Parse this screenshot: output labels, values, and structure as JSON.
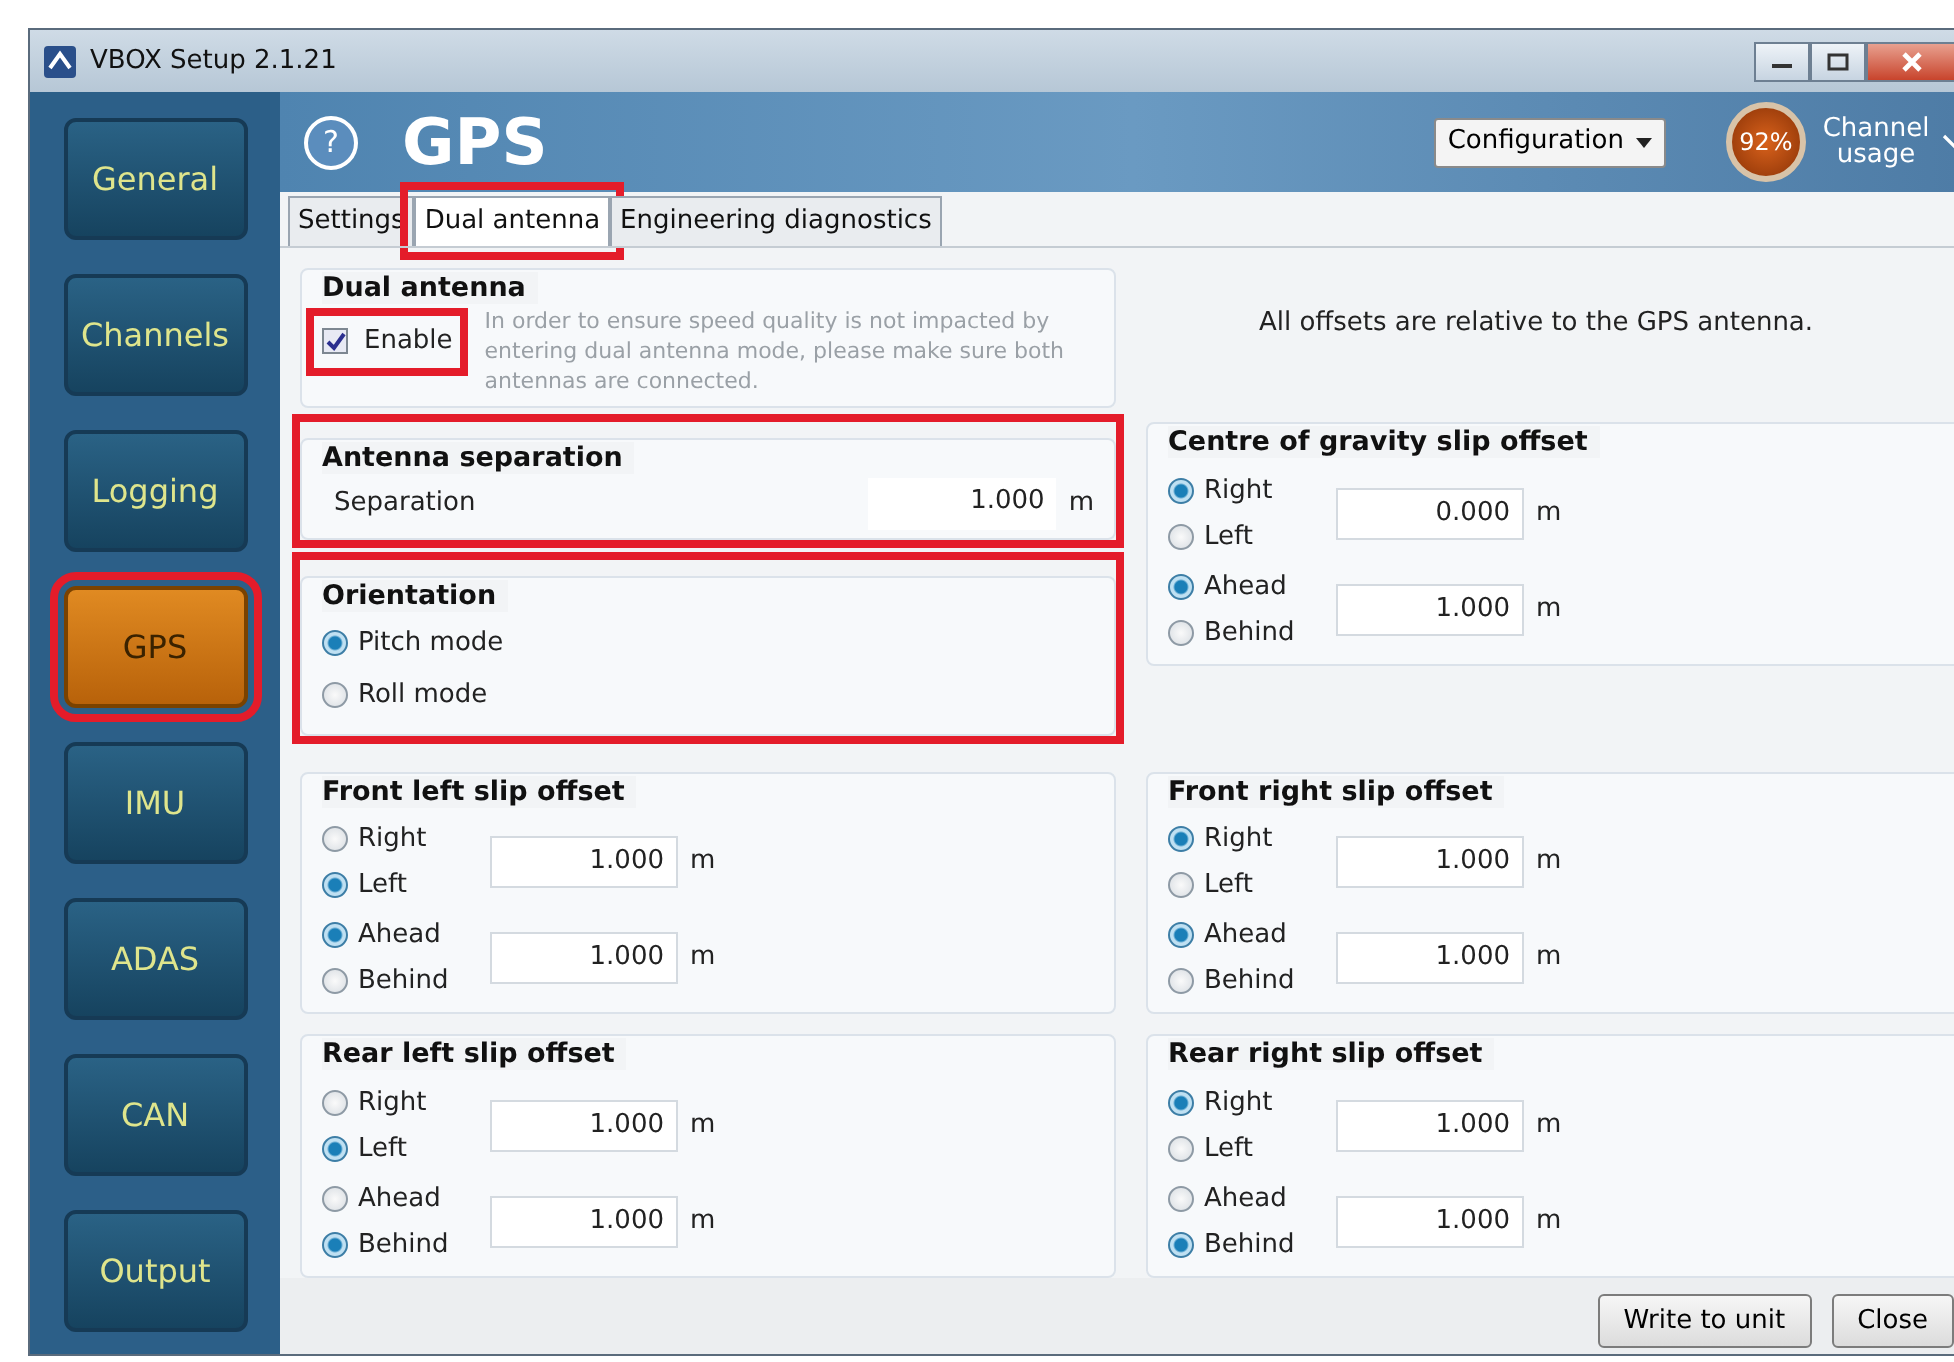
{
  "window": {
    "title": "VBOX Setup 2.1.21"
  },
  "sidebar": {
    "items": [
      {
        "label": "General",
        "selected": false,
        "highlighted": false
      },
      {
        "label": "Channels",
        "selected": false,
        "highlighted": false
      },
      {
        "label": "Logging",
        "selected": false,
        "highlighted": false
      },
      {
        "label": "GPS",
        "selected": true,
        "highlighted": true
      },
      {
        "label": "IMU",
        "selected": false,
        "highlighted": false
      },
      {
        "label": "ADAS",
        "selected": false,
        "highlighted": false
      },
      {
        "label": "CAN",
        "selected": false,
        "highlighted": false
      },
      {
        "label": "Output",
        "selected": false,
        "highlighted": false
      }
    ]
  },
  "header": {
    "help": "?",
    "title": "GPS",
    "configuration": "Configuration",
    "usage_percent": "92%",
    "usage_label": "Channel usage"
  },
  "tabs": [
    {
      "label": "Settings",
      "selected": false,
      "highlighted": false
    },
    {
      "label": "Dual antenna",
      "selected": true,
      "highlighted": true
    },
    {
      "label": "Engineering diagnostics",
      "selected": false,
      "highlighted": false
    }
  ],
  "dual_antenna": {
    "title": "Dual antenna",
    "enable": {
      "label": "Enable",
      "checked": true,
      "highlighted": true
    },
    "note": "In order to ensure speed quality is not impacted by entering dual antenna mode, please make sure both antennas are connected."
  },
  "offsets_note": "All offsets are relative to the GPS antenna.",
  "antenna_separation": {
    "title": "Antenna separation",
    "highlighted": true,
    "label": "Separation",
    "value": "1.000",
    "unit": "m"
  },
  "orientation": {
    "title": "Orientation",
    "highlighted": true,
    "options": [
      {
        "label": "Pitch mode",
        "selected": true
      },
      {
        "label": "Roll mode",
        "selected": false
      }
    ]
  },
  "cog_offset": {
    "title": "Centre of gravity slip offset",
    "rows": [
      {
        "options": [
          {
            "label": "Right",
            "selected": true
          },
          {
            "label": "Left",
            "selected": false
          }
        ],
        "value": "0.000",
        "unit": "m"
      },
      {
        "options": [
          {
            "label": "Ahead",
            "selected": true
          },
          {
            "label": "Behind",
            "selected": false
          }
        ],
        "value": "1.000",
        "unit": "m"
      }
    ]
  },
  "wheel_offsets": [
    {
      "title": "Front left slip offset",
      "rows": [
        {
          "options": [
            {
              "label": "Right",
              "selected": false
            },
            {
              "label": "Left",
              "selected": true
            }
          ],
          "value": "1.000",
          "unit": "m"
        },
        {
          "options": [
            {
              "label": "Ahead",
              "selected": true
            },
            {
              "label": "Behind",
              "selected": false
            }
          ],
          "value": "1.000",
          "unit": "m"
        }
      ]
    },
    {
      "title": "Front right slip offset",
      "rows": [
        {
          "options": [
            {
              "label": "Right",
              "selected": true
            },
            {
              "label": "Left",
              "selected": false
            }
          ],
          "value": "1.000",
          "unit": "m"
        },
        {
          "options": [
            {
              "label": "Ahead",
              "selected": true
            },
            {
              "label": "Behind",
              "selected": false
            }
          ],
          "value": "1.000",
          "unit": "m"
        }
      ]
    },
    {
      "title": "Rear left slip offset",
      "rows": [
        {
          "options": [
            {
              "label": "Right",
              "selected": false
            },
            {
              "label": "Left",
              "selected": true
            }
          ],
          "value": "1.000",
          "unit": "m"
        },
        {
          "options": [
            {
              "label": "Ahead",
              "selected": false
            },
            {
              "label": "Behind",
              "selected": true
            }
          ],
          "value": "1.000",
          "unit": "m"
        }
      ]
    },
    {
      "title": "Rear right slip offset",
      "rows": [
        {
          "options": [
            {
              "label": "Right",
              "selected": true
            },
            {
              "label": "Left",
              "selected": false
            }
          ],
          "value": "1.000",
          "unit": "m"
        },
        {
          "options": [
            {
              "label": "Ahead",
              "selected": false
            },
            {
              "label": "Behind",
              "selected": true
            }
          ],
          "value": "1.000",
          "unit": "m"
        }
      ]
    }
  ],
  "buttons": [
    "Write to unit",
    "Close"
  ]
}
